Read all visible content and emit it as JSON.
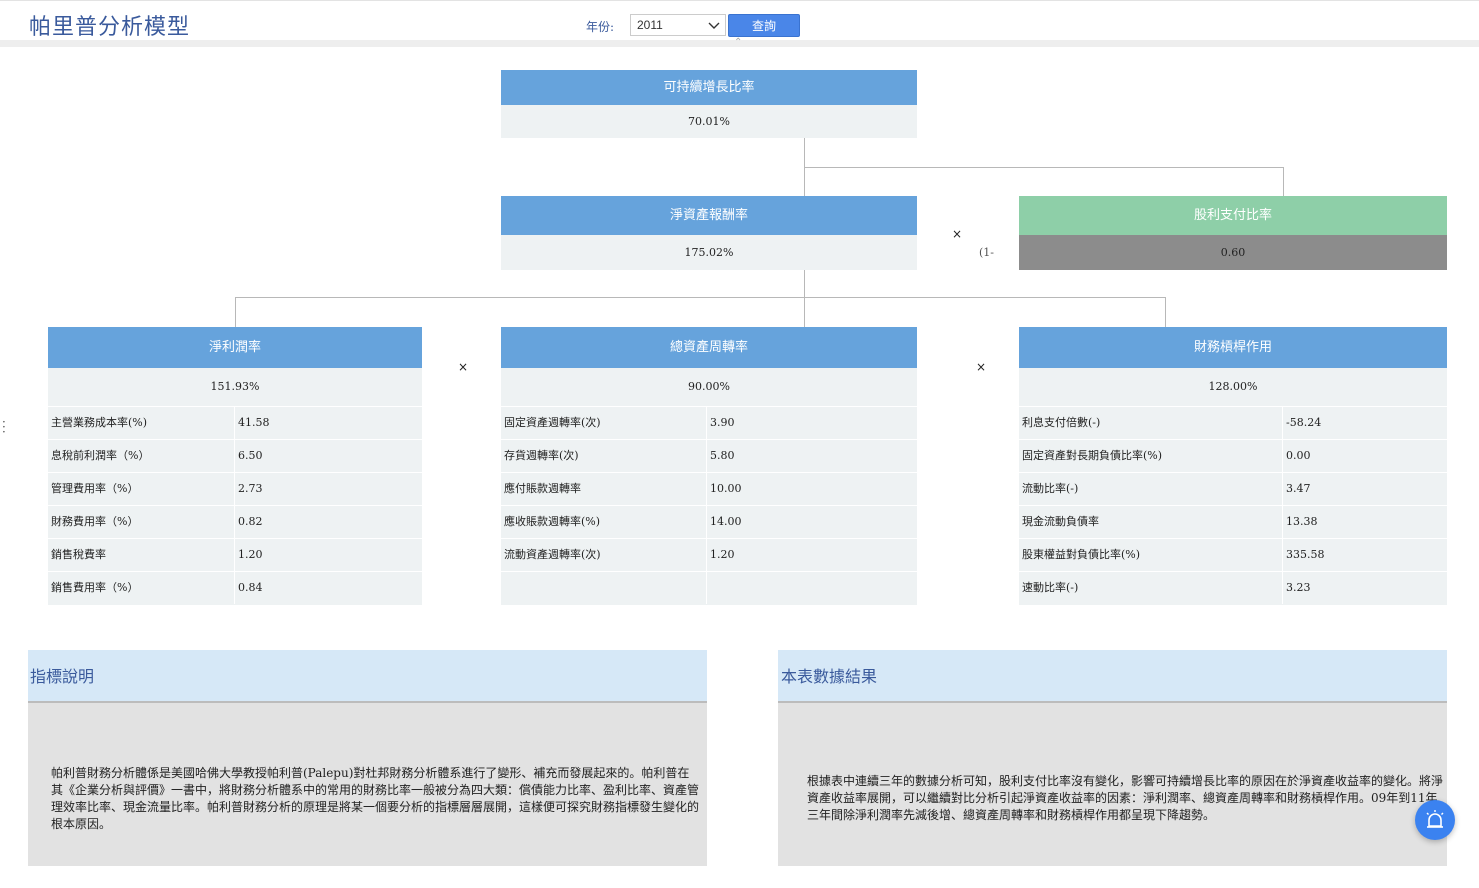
{
  "header": {
    "title": "帕里普分析模型",
    "year_label": "年份:",
    "year_value": "2011",
    "query_label": "查詢"
  },
  "tree": {
    "sustainable_growth": {
      "label": "可持續增長比率",
      "value": "70.01%"
    },
    "roe": {
      "label": "淨資產報酬率",
      "value": "175.02%"
    },
    "dividend_payout": {
      "label": "股利支付比率",
      "value": "0.60"
    },
    "operators": {
      "times": "×",
      "one_minus": "(1-"
    }
  },
  "net_margin": {
    "label": "淨利潤率",
    "value": "151.93%",
    "rows": [
      {
        "name": "主營業務成本率(%)",
        "value": "41.58"
      },
      {
        "name": "息稅前利潤率（%）",
        "value": "6.50"
      },
      {
        "name": "管理費用率（%）",
        "value": "2.73"
      },
      {
        "name": "財務費用率（%）",
        "value": "0.82"
      },
      {
        "name": "銷售稅費率",
        "value": "1.20"
      },
      {
        "name": "銷售費用率（%）",
        "value": "0.84"
      }
    ]
  },
  "asset_turnover": {
    "label": "總資產周轉率",
    "value": "90.00%",
    "rows": [
      {
        "name": "固定資產週轉率(次)",
        "value": "3.90"
      },
      {
        "name": "存貨週轉率(次)",
        "value": "5.80"
      },
      {
        "name": "應付賬款週轉率",
        "value": "10.00"
      },
      {
        "name": "應收賬款週轉率(%)",
        "value": "14.00"
      },
      {
        "name": "流動資產週轉率(次)",
        "value": "1.20"
      },
      {
        "name": "",
        "value": ""
      }
    ]
  },
  "leverage": {
    "label": "財務槓桿作用",
    "value": "128.00%",
    "rows": [
      {
        "name": "利息支付倍數(-)",
        "value": "-58.24"
      },
      {
        "name": "固定資產對長期負債比率(%)",
        "value": "0.00"
      },
      {
        "name": "流動比率(-)",
        "value": "3.47"
      },
      {
        "name": "現金流動負債率",
        "value": "13.38"
      },
      {
        "name": "股東權益對負債比率(%)",
        "value": "335.58"
      },
      {
        "name": "速動比率(-)",
        "value": "3.23"
      }
    ]
  },
  "panels": {
    "indicator": {
      "title": "指標說明",
      "body": "帕利普財務分析體係是美國哈佛大學教授帕利普(Palepu)對杜邦財務分析體系進行了變形、補充而發展起來的。帕利普在其《企業分析與評價》一書中，將財務分析體系中的常用的財務比率一般被分為四大類：償債能力比率、盈利比率、資產管理效率比率、現金流量比率。帕利普財務分析的原理是將某一個要分析的指標層層展開，這樣便可探究財務指標發生變化的根本原因。"
    },
    "result": {
      "title": "本表數據結果",
      "body": "根據表中連續三年的數據分析可知，股利支付比率沒有變化，影響可持續增長比率的原因在於淨資產收益率的變化。將淨資產收益率展開，可以繼續對比分析引起淨資產收益率的因素：淨利潤率、總資產周轉率和財務槓桿作用。09年到11年三年間除淨利潤率先減後增、總資產周轉率和財務槓桿作用都呈現下降趨勢。"
    }
  },
  "colors": {
    "header_blue": "#66a3dc",
    "header_green": "#8ecfa8",
    "value_bg": "#eef2f3",
    "grey_value": "#8c8c8c",
    "title_blue": "#3a5a9c",
    "button_blue": "#4a86e8"
  },
  "icons": {
    "dropdown": "chevron-down-icon",
    "collapse": "collapse-up-icon",
    "more": "more-vertical-icon",
    "fab": "alarm-icon"
  }
}
